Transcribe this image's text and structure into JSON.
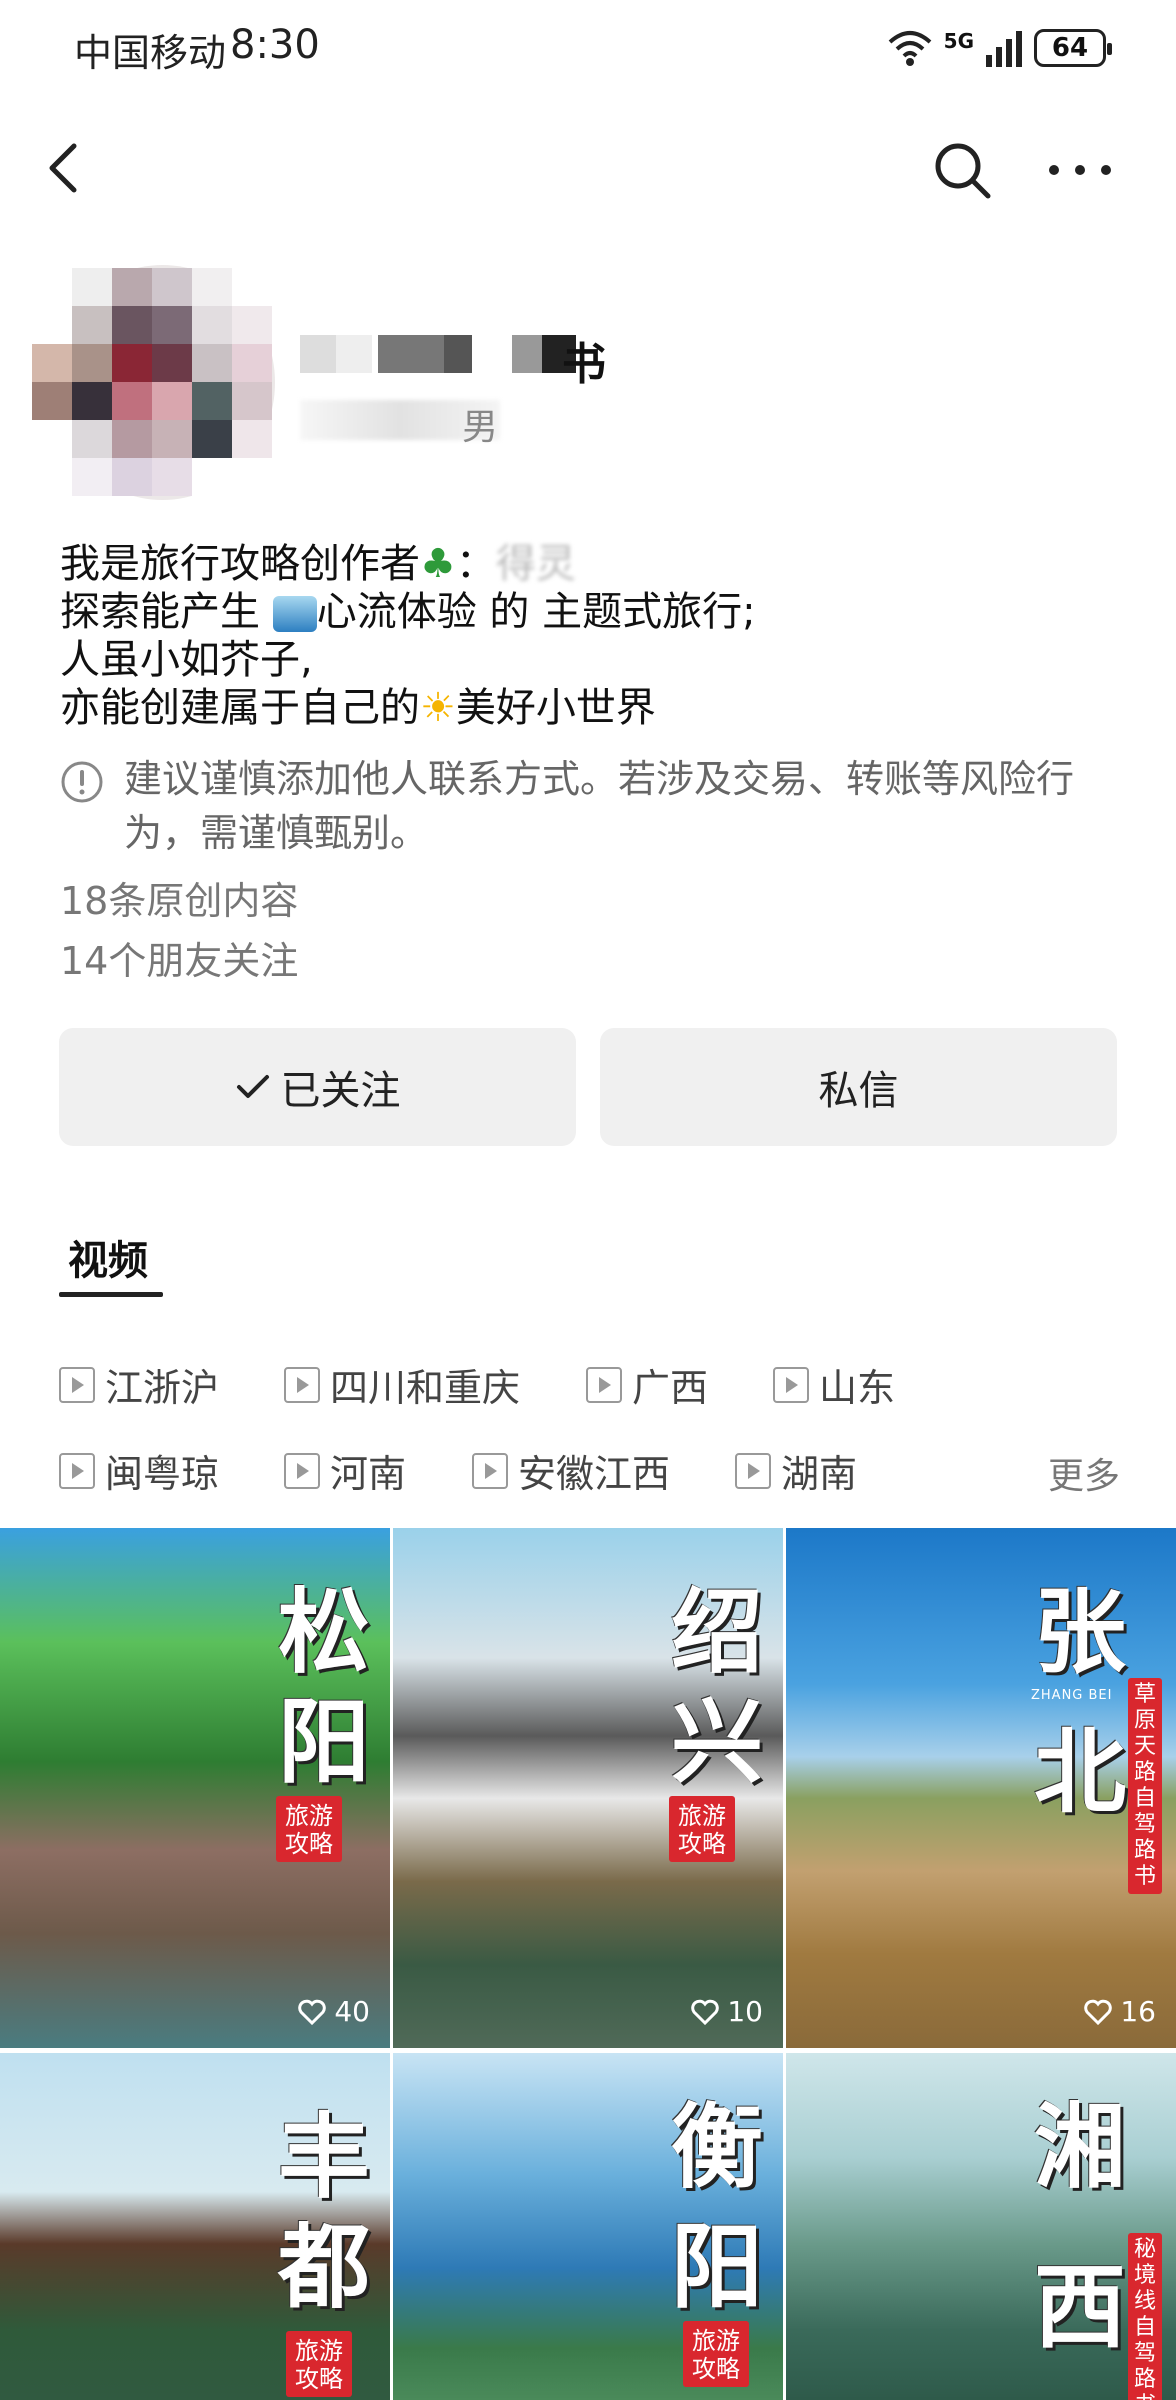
{
  "status_bar": {
    "carrier": "中国移动",
    "time": "8:30",
    "network": "5G",
    "battery": "64"
  },
  "icons": {
    "back": "chevron-left-icon",
    "search": "search-icon",
    "more": "more-dots-icon",
    "wifi": "wifi-icon",
    "signal": "signal-icon",
    "warning": "info-circle-icon",
    "play": "play-icon",
    "heart": "heart-icon",
    "check": "check-icon"
  },
  "profile": {
    "name_visible": "书",
    "gender": "男",
    "bio": {
      "line1_a": "我是旅行攻略创作者",
      "line1_b": "：",
      "line1_c": "得灵",
      "line2_a": "探索能产生",
      "line2_b": "心流体验 的 主题式旅行;",
      "line3": "人虽小如芥子,",
      "line4_a": "亦能创建属于自己的",
      "line4_b": "美好小世界"
    },
    "warning": "建议谨慎添加他人联系方式。若涉及交易、转账等风险行为，需谨慎甄别。",
    "original_count": "18条原创内容",
    "friends_follow": "14个朋友关注"
  },
  "actions": {
    "follow": "已关注",
    "message": "私信"
  },
  "tab": {
    "label": "视频"
  },
  "collections": [
    "江浙沪",
    "四川和重庆",
    "广西",
    "山东",
    "闽粤琼",
    "河南",
    "安徽江西",
    "湖南"
  ],
  "more_label": "更多",
  "videos": [
    {
      "t1": "松",
      "t2": "阳",
      "stamp": "旅游攻略",
      "likes": "40"
    },
    {
      "t1": "绍",
      "t2": "兴",
      "stamp": "旅游攻略",
      "likes": "10"
    },
    {
      "t1": "张",
      "t2": "北",
      "stamp": "草原天路自驾路书",
      "sub": "ZHANG BEI",
      "likes": "16"
    },
    {
      "t1": "丰",
      "t2": "都",
      "stamp": "旅游攻略"
    },
    {
      "t1": "衡",
      "t2": "阳",
      "stamp": "旅游攻略"
    },
    {
      "t1": "湘",
      "t2": "西",
      "stamp": "秘境线自驾路书"
    }
  ],
  "colors": {
    "accent_red": "#d9272e",
    "button_bg": "#f0f0f0",
    "muted_text": "#777777"
  }
}
